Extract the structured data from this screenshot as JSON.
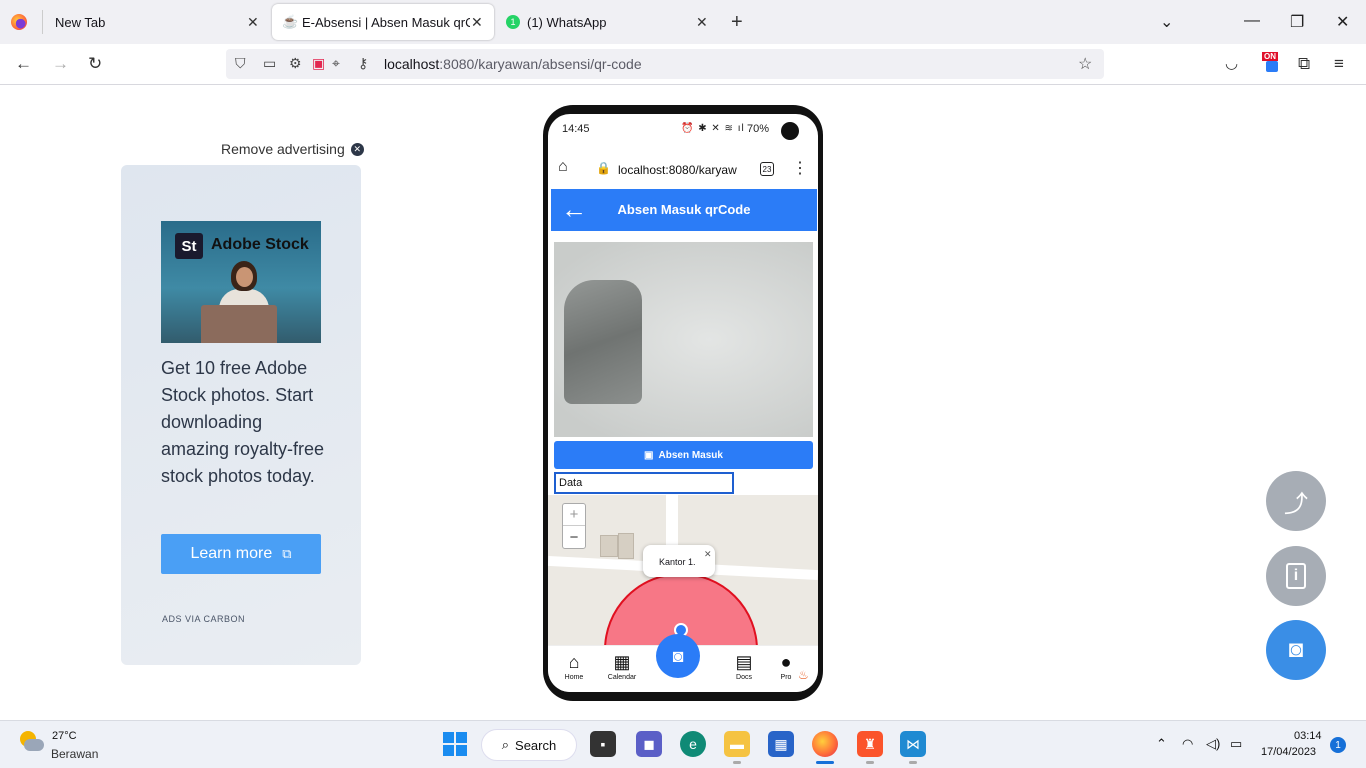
{
  "browser": {
    "tabs": [
      {
        "label": "New Tab",
        "active": false
      },
      {
        "label": "E-Absensi | Absen Masuk qrCod",
        "active": true
      },
      {
        "label": "(1) WhatsApp",
        "active": false
      }
    ],
    "url_host": "localhost",
    "url_path": ":8080/karyawan/absensi/qr-code"
  },
  "ad": {
    "remove_label": "Remove advertising",
    "brand_badge": "St",
    "brand_name": "Adobe Stock",
    "text": "Get 10 free Adobe Stock photos. Start downloading amazing royalty-free stock photos today.",
    "cta": "Learn more",
    "via": "ADS VIA CARBON"
  },
  "phone": {
    "status_time": "14:45",
    "battery": "70%",
    "browser_url": "localhost:8080/karyaw",
    "tab_count": "23",
    "header_title": "Absen Masuk qrCode",
    "absen_button": "Absen Masuk",
    "data_input_value": "Data",
    "map_zoom_in": "+",
    "map_zoom_out": "−",
    "map_popup": "Kantor 1.",
    "nav": {
      "home": "Home",
      "calendar": "Calendar",
      "docs": "Docs",
      "profile": "Pro"
    }
  },
  "taskbar": {
    "temperature": "27°C",
    "weather": "Berawan",
    "search": "Search",
    "time": "03:14",
    "date": "17/04/2023",
    "notification_count": "1"
  },
  "colors": {
    "primary": "#2b7cf7",
    "fab_grey": "#a7adb5",
    "fab_blue": "#3a8ee6",
    "geofence": "#e01020"
  }
}
